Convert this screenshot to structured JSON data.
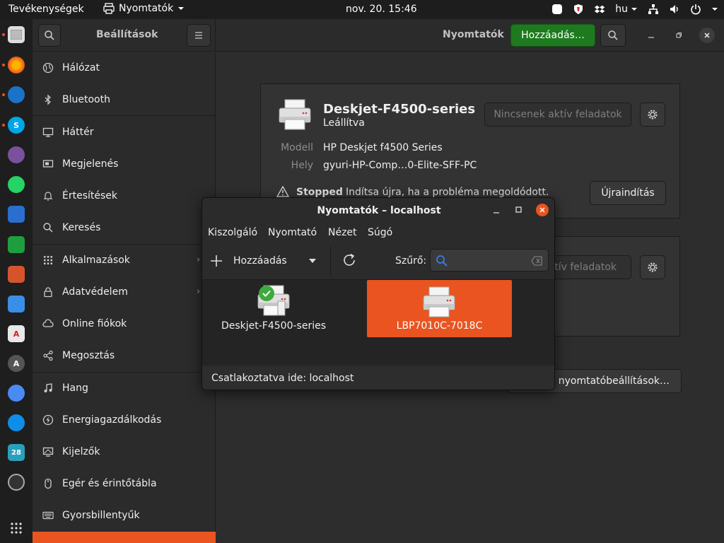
{
  "topbar": {
    "activities": "Tevékenységek",
    "app_name": "Nyomtatók",
    "clock": "nov. 20.  15:46",
    "lang": "hu"
  },
  "settings": {
    "title": "Beállítások",
    "items": [
      {
        "label": "Hálózat",
        "icon": "globe-icon"
      },
      {
        "label": "Bluetooth",
        "icon": "bluetooth-icon"
      },
      {
        "label": "Háttér",
        "icon": "monitor-icon"
      },
      {
        "label": "Megjelenés",
        "icon": "appearance-icon"
      },
      {
        "label": "Értesítések",
        "icon": "bell-icon"
      },
      {
        "label": "Keresés",
        "icon": "search-icon"
      },
      {
        "label": "Alkalmazások",
        "icon": "grid-icon"
      },
      {
        "label": "Adatvédelem",
        "icon": "lock-icon"
      },
      {
        "label": "Online fiókok",
        "icon": "cloud-icon"
      },
      {
        "label": "Megosztás",
        "icon": "share-icon"
      },
      {
        "label": "Hang",
        "icon": "music-icon"
      },
      {
        "label": "Energiagazdálkodás",
        "icon": "power-icon"
      },
      {
        "label": "Kijelzők",
        "icon": "display-icon"
      },
      {
        "label": "Egér és érintőtábla",
        "icon": "mouse-icon"
      },
      {
        "label": "Gyorsbillentyűk",
        "icon": "keyboard-icon"
      }
    ]
  },
  "main": {
    "title": "Nyomtatók",
    "add_label": "Hozzáadás…",
    "printer1": {
      "name": "Deskjet-F4500-series",
      "state": "Leállítva",
      "model_key": "Modell",
      "model_val": "HP Deskjet f4500 Series",
      "location_key": "Hely",
      "location_val": "gyuri-HP-Comp…0-Elite-SFF-PC",
      "jobs_label": "Nincsenek aktív feladatok",
      "stopped_label": "Stopped",
      "stopped_msg": "Indítsa újra, ha a probléma megoldódott.",
      "restart_label": "Újraindítás"
    },
    "printer2": {
      "jobs_label": "aktív feladatok"
    },
    "additional_label": "nyomtatóbeállítások…"
  },
  "dialog": {
    "title": "Nyomtatók – localhost",
    "menu": [
      "Kiszolgáló",
      "Nyomtató",
      "Nézet",
      "Súgó"
    ],
    "add_label": "Hozzáadás",
    "filter_label": "Szűrő:",
    "filter_value": "",
    "printers": [
      {
        "name": "Deskjet-F4500-series",
        "default": true,
        "selected": false
      },
      {
        "name": "LBP7010C-7018C",
        "default": false,
        "selected": true
      }
    ],
    "status": "Csatlakoztatva ide: localhost"
  },
  "colors": {
    "accent": "#e95420",
    "add_button": "#1e7a1e",
    "check": "#3daa3d"
  }
}
